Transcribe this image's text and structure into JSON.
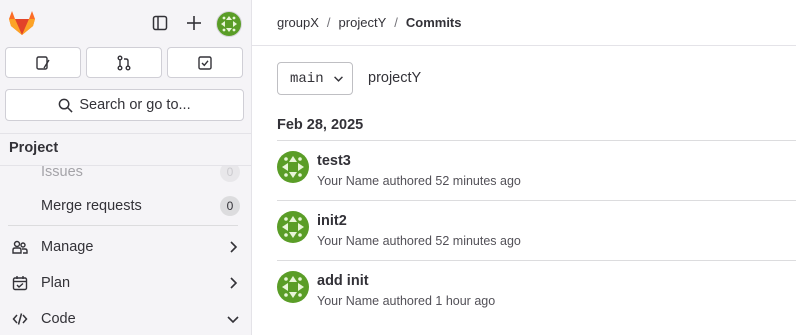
{
  "sidebar": {
    "search_label": "Search or go to...",
    "section_title": "Project",
    "nav": {
      "issues": {
        "label": "Issues",
        "count": "0"
      },
      "merge_requests": {
        "label": "Merge requests",
        "count": "0"
      },
      "manage": {
        "label": "Manage"
      },
      "plan": {
        "label": "Plan"
      },
      "code": {
        "label": "Code"
      }
    }
  },
  "breadcrumb": [
    "groupX",
    "projectY",
    "Commits"
  ],
  "branch": "main",
  "project_path": "projectY",
  "date_heading": "Feb 28, 2025",
  "commits": [
    {
      "title": "test3",
      "author": "Your Name",
      "action": "authored",
      "time": "52 minutes ago"
    },
    {
      "title": "init2",
      "author": "Your Name",
      "action": "authored",
      "time": "52 minutes ago"
    },
    {
      "title": "add init",
      "author": "Your Name",
      "action": "authored",
      "time": "1 hour ago"
    }
  ],
  "colors": {
    "avatar_green": "#5a9d27",
    "logo_orange": "#e24329"
  }
}
